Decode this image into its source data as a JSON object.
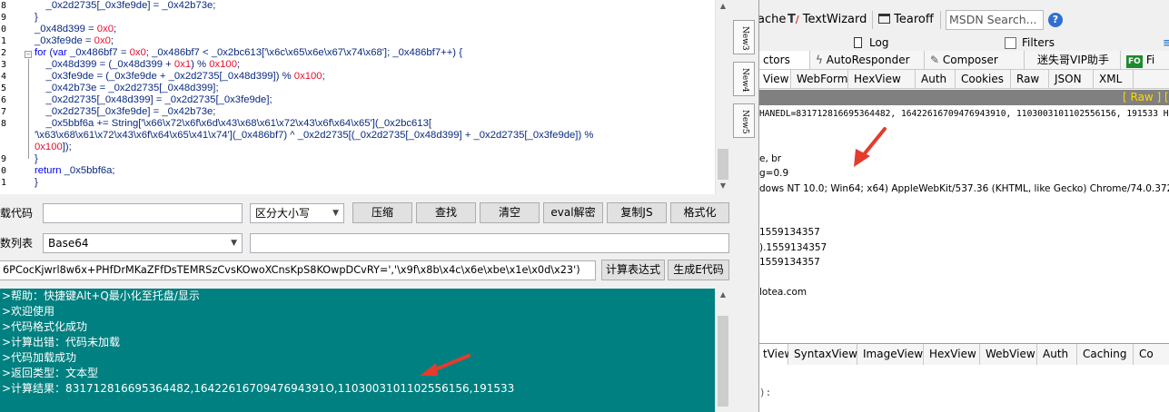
{
  "code": {
    "line_numbers": [
      "8",
      "9",
      "0",
      "1",
      "2",
      "3",
      "4",
      "5",
      "6",
      "7",
      "8",
      "",
      "",
      "9",
      "0",
      "1"
    ],
    "lines": [
      {
        "segments": [
          {
            "t": "    _0x2d2735[_0x3fe9de] = _0x42b73e;"
          }
        ]
      },
      {
        "segments": [
          {
            "t": "}"
          }
        ]
      },
      {
        "segments": [
          {
            "t": "_0x48d399 = "
          },
          {
            "t": "0x0",
            "c": "n"
          },
          {
            "t": ";"
          }
        ]
      },
      {
        "segments": [
          {
            "t": "_0x3fe9de = "
          },
          {
            "t": "0x0",
            "c": "n"
          },
          {
            "t": ";"
          }
        ]
      },
      {
        "segments": [
          {
            "t": "for",
            "c": "k"
          },
          {
            "t": " ("
          },
          {
            "t": "var",
            "c": "k"
          },
          {
            "t": " _0x486bf7 = "
          },
          {
            "t": "0x0",
            "c": "n"
          },
          {
            "t": "; _0x486bf7 < _0x2bc613['\\x6c\\x65\\x6e\\x67\\x74\\x68']; _0x486bf7++) {"
          }
        ]
      },
      {
        "segments": [
          {
            "t": "    _0x48d399 = (_0x48d399 + "
          },
          {
            "t": "0x1",
            "c": "n"
          },
          {
            "t": ") % "
          },
          {
            "t": "0x100",
            "c": "n"
          },
          {
            "t": ";"
          }
        ]
      },
      {
        "segments": [
          {
            "t": "    _0x3fe9de = (_0x3fe9de + _0x2d2735[_0x48d399]) % "
          },
          {
            "t": "0x100",
            "c": "n"
          },
          {
            "t": ";"
          }
        ]
      },
      {
        "segments": [
          {
            "t": "    _0x42b73e = _0x2d2735[_0x48d399];"
          }
        ]
      },
      {
        "segments": [
          {
            "t": "    _0x2d2735[_0x48d399] = _0x2d2735[_0x3fe9de];"
          }
        ]
      },
      {
        "segments": [
          {
            "t": "    _0x2d2735[_0x3fe9de] = _0x42b73e;"
          }
        ]
      },
      {
        "segments": [
          {
            "t": "    _0x5bbf6a += String['\\x66\\x72\\x6f\\x6d\\x43\\x68\\x61\\x72\\x43\\x6f\\x64\\x65'](_0x2bc613["
          }
        ]
      },
      {
        "segments": [
          {
            "t": "'\\x63\\x68\\x61\\x72\\x43\\x6f\\x64\\x65\\x41\\x74'](_0x486bf7) ^ _0x2d2735[(_0x2d2735[_0x48d399] + _0x2d2735[_0x3fe9de]) % "
          }
        ]
      },
      {
        "segments": [
          {
            "t": "0x100",
            "c": "n"
          },
          {
            "t": "]);"
          }
        ]
      },
      {
        "segments": [
          {
            "t": "}"
          }
        ]
      },
      {
        "segments": [
          {
            "t": "return",
            "c": "k"
          },
          {
            "t": " _0x5bbf6a;"
          }
        ]
      },
      {
        "segments": [
          {
            "t": "}"
          }
        ]
      }
    ]
  },
  "vtabs": [
    "New3",
    "New4",
    "New5"
  ],
  "toolbar": {
    "load_label": "载代码",
    "load_value": "",
    "case_select": "区分大小写",
    "compress": "压缩",
    "find": "查找",
    "clear": "清空",
    "eval_decrypt": "eval解密",
    "copy_js": "复制JS",
    "format": "格式化"
  },
  "row2": {
    "label": "数列表",
    "select": "Base64",
    "input": ""
  },
  "row3": {
    "expression": "6PCocKjwrl8w6x+PHfDrMKaZFfDsTEMRSzCvsKOwoXCnsKpS8KOwpDCvRY=','\\x9f\\x8b\\x4c\\x6e\\xbe\\x1e\\x0d\\x23')",
    "calc_expr": "计算表达式",
    "gen_e": "生成E代码"
  },
  "console": [
    ">帮助：快捷键Alt+Q最小化至托盘/显示",
    ">欢迎使用",
    ">代码格式化成功",
    ">计算出错：代码未加载",
    ">代码加载成功",
    ">返回类型：文本型",
    ">计算结果：831712816695364482,1642261670947694391O,1103003101102556156,191533"
  ],
  "fiddler": {
    "toolbar": {
      "cache": "ache",
      "textwizard": "TextWizard",
      "tearoff": "Tearoff",
      "msdn": "MSDN Search...",
      "help": "?"
    },
    "log": "Log",
    "filters": "Filters",
    "tabs1": [
      "ctors",
      "AutoResponder",
      "Composer",
      "迷失哥VIP助手",
      "Fi"
    ],
    "tabs2": [
      "View",
      "WebForms",
      "HexView",
      "Auth",
      "Cookies",
      "Raw",
      "JSON",
      "XML"
    ],
    "raw_bar": {
      "raw": "[ Raw ]",
      "right": "["
    },
    "response_lines": [
      "HANEDL=831712816695364482, 16422616709476943910, 1103003101102556156, 191533 H",
      "",
      "",
      "e, br",
      "g=0.9",
      "dows NT 10.0; Win64; x64) AppleWebKit/537.36 (KHTML, like Gecko) Chrome/74.0.3729.108 S",
      "",
      "",
      "1559134357",
      ").1559134357",
      "1559134357",
      "",
      "lotea.com"
    ],
    "tabs3": [
      "tView",
      "SyntaxView",
      "ImageView",
      "HexView",
      "WebView",
      "Auth",
      "Caching",
      "Co"
    ],
    "bottom_text": "):"
  },
  "colors": {
    "console_bg": "#008080",
    "raw_bar_bg": "#808080",
    "raw_text": "#ffd700",
    "arrow": "#e53b2c",
    "number": "#e8102e",
    "keyword": "#0000ff"
  }
}
